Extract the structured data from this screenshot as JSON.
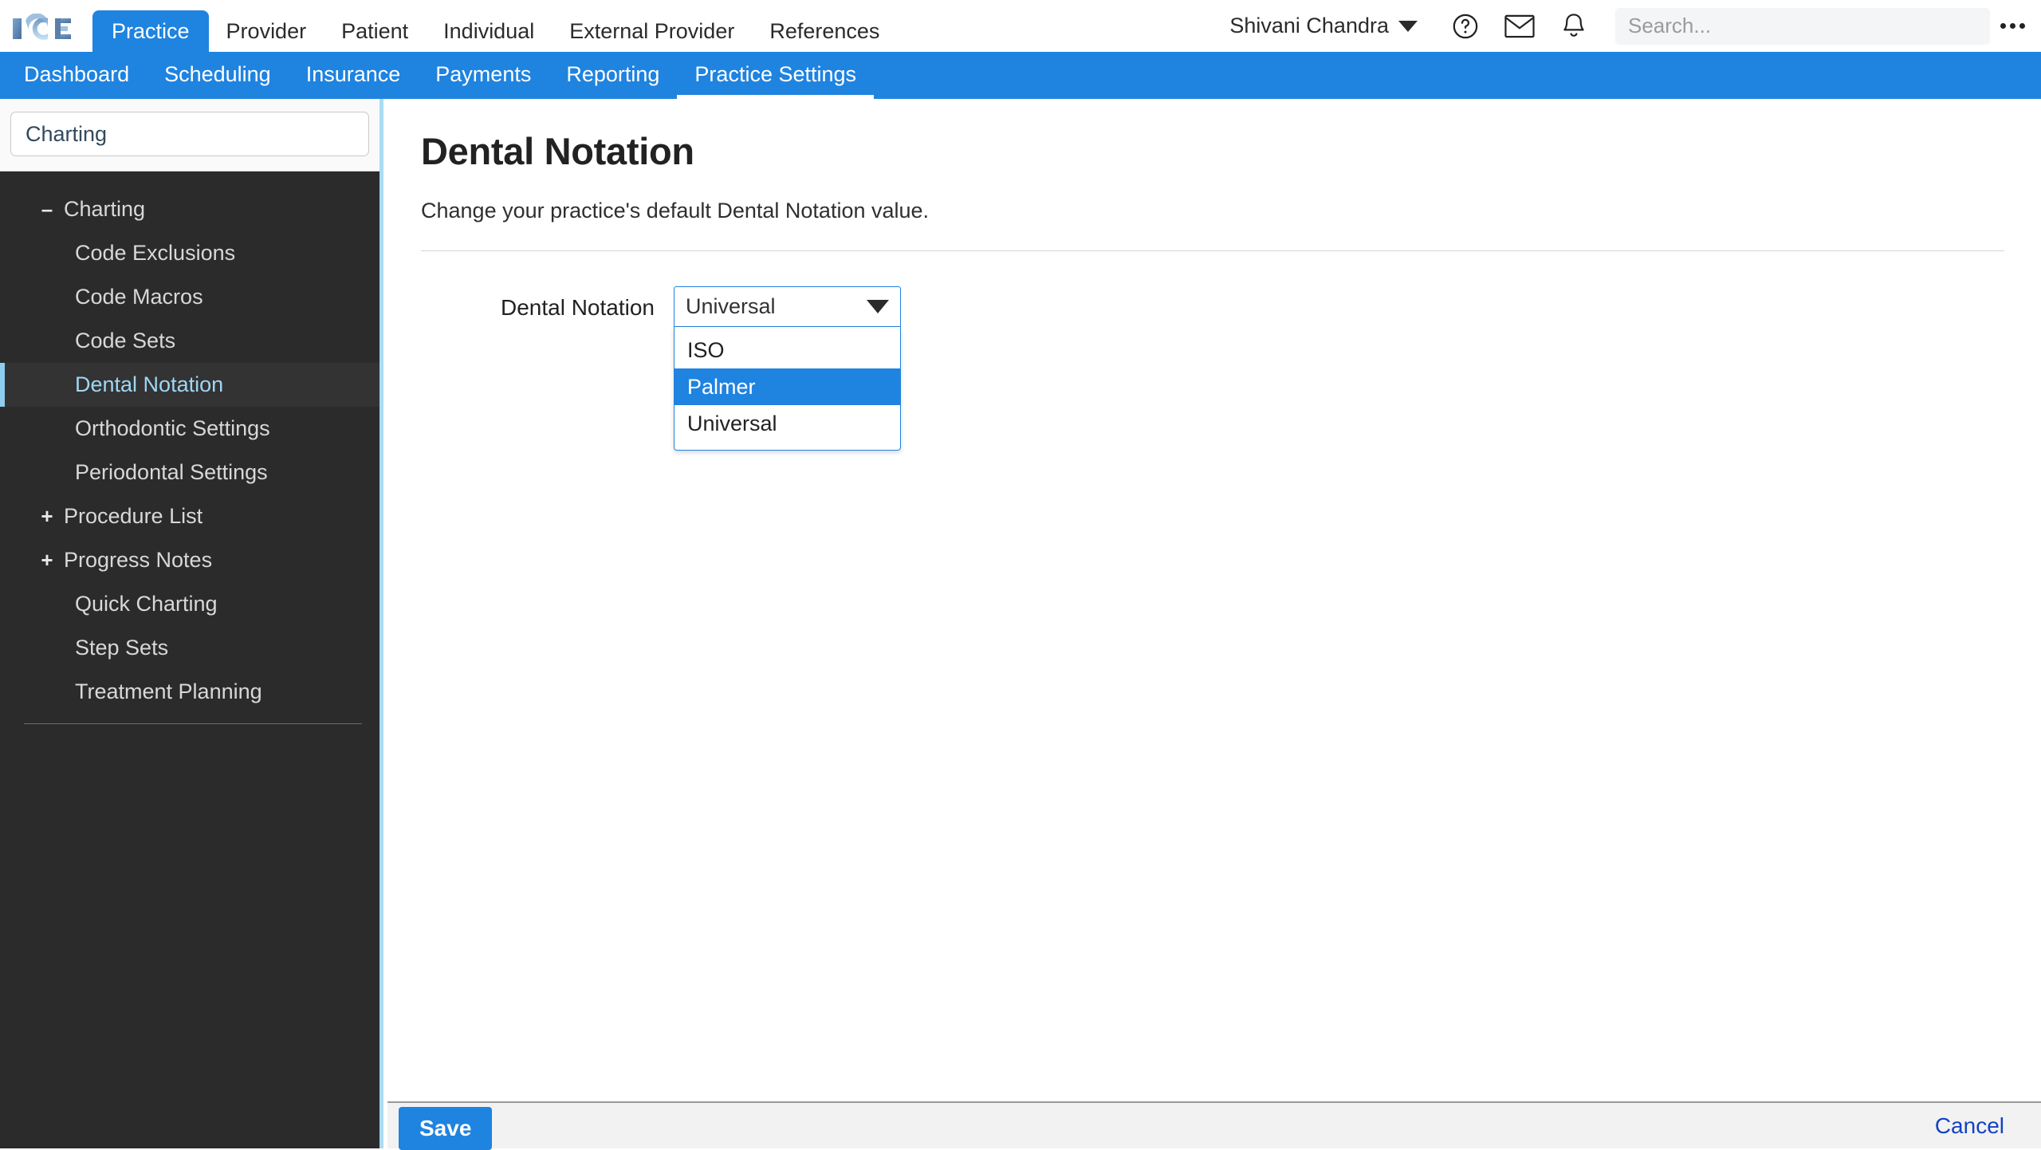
{
  "brand": {
    "logo_text": "ICE"
  },
  "topnav": {
    "tabs": [
      {
        "label": "Practice",
        "active": true
      },
      {
        "label": "Provider",
        "active": false
      },
      {
        "label": "Patient",
        "active": false
      },
      {
        "label": "Individual",
        "active": false
      },
      {
        "label": "External Provider",
        "active": false
      },
      {
        "label": "References",
        "active": false
      }
    ],
    "user_name": "Shivani Chandra",
    "icons": [
      "help-icon",
      "mail-icon",
      "bell-icon"
    ],
    "search_placeholder": "Search...",
    "search_value": "",
    "overflow_label": "more-options"
  },
  "subnav": {
    "tabs": [
      {
        "label": "Dashboard",
        "active": false
      },
      {
        "label": "Scheduling",
        "active": false
      },
      {
        "label": "Insurance",
        "active": false
      },
      {
        "label": "Payments",
        "active": false
      },
      {
        "label": "Reporting",
        "active": false
      },
      {
        "label": "Practice Settings",
        "active": true
      }
    ]
  },
  "sidebar": {
    "filter_value": "Charting",
    "filter_placeholder": "",
    "items": [
      {
        "label": "Charting",
        "level": 1,
        "toggle": "–",
        "selected": false
      },
      {
        "label": "Code Exclusions",
        "level": 2,
        "toggle": "",
        "selected": false
      },
      {
        "label": "Code Macros",
        "level": 2,
        "toggle": "",
        "selected": false
      },
      {
        "label": "Code Sets",
        "level": 2,
        "toggle": "",
        "selected": false
      },
      {
        "label": "Dental Notation",
        "level": 2,
        "toggle": "",
        "selected": true
      },
      {
        "label": "Orthodontic Settings",
        "level": 2,
        "toggle": "",
        "selected": false
      },
      {
        "label": "Periodontal Settings",
        "level": 2,
        "toggle": "",
        "selected": false
      },
      {
        "label": "Procedure List",
        "level": 1,
        "toggle": "+",
        "selected": false
      },
      {
        "label": "Progress Notes",
        "level": 1,
        "toggle": "+",
        "selected": false
      },
      {
        "label": "Quick Charting",
        "level": 2,
        "toggle": "",
        "selected": false
      },
      {
        "label": "Step Sets",
        "level": 2,
        "toggle": "",
        "selected": false
      },
      {
        "label": "Treatment Planning",
        "level": 2,
        "toggle": "",
        "selected": false
      }
    ]
  },
  "main": {
    "title": "Dental Notation",
    "description": "Change your practice's default Dental Notation value.",
    "field_label": "Dental Notation",
    "field_value": "Universal",
    "options": [
      {
        "label": "ISO",
        "highlighted": false
      },
      {
        "label": "Palmer",
        "highlighted": true
      },
      {
        "label": "Universal",
        "highlighted": false
      }
    ]
  },
  "footer": {
    "save_label": "Save",
    "cancel_label": "Cancel"
  },
  "colors": {
    "brand_blue": "#1f83e0",
    "sidebar_bg": "#2b2b2b",
    "sidebar_accent": "#8ecdf0",
    "sidebar_border": "#aadcf5",
    "cancel_link": "#1343c4"
  }
}
